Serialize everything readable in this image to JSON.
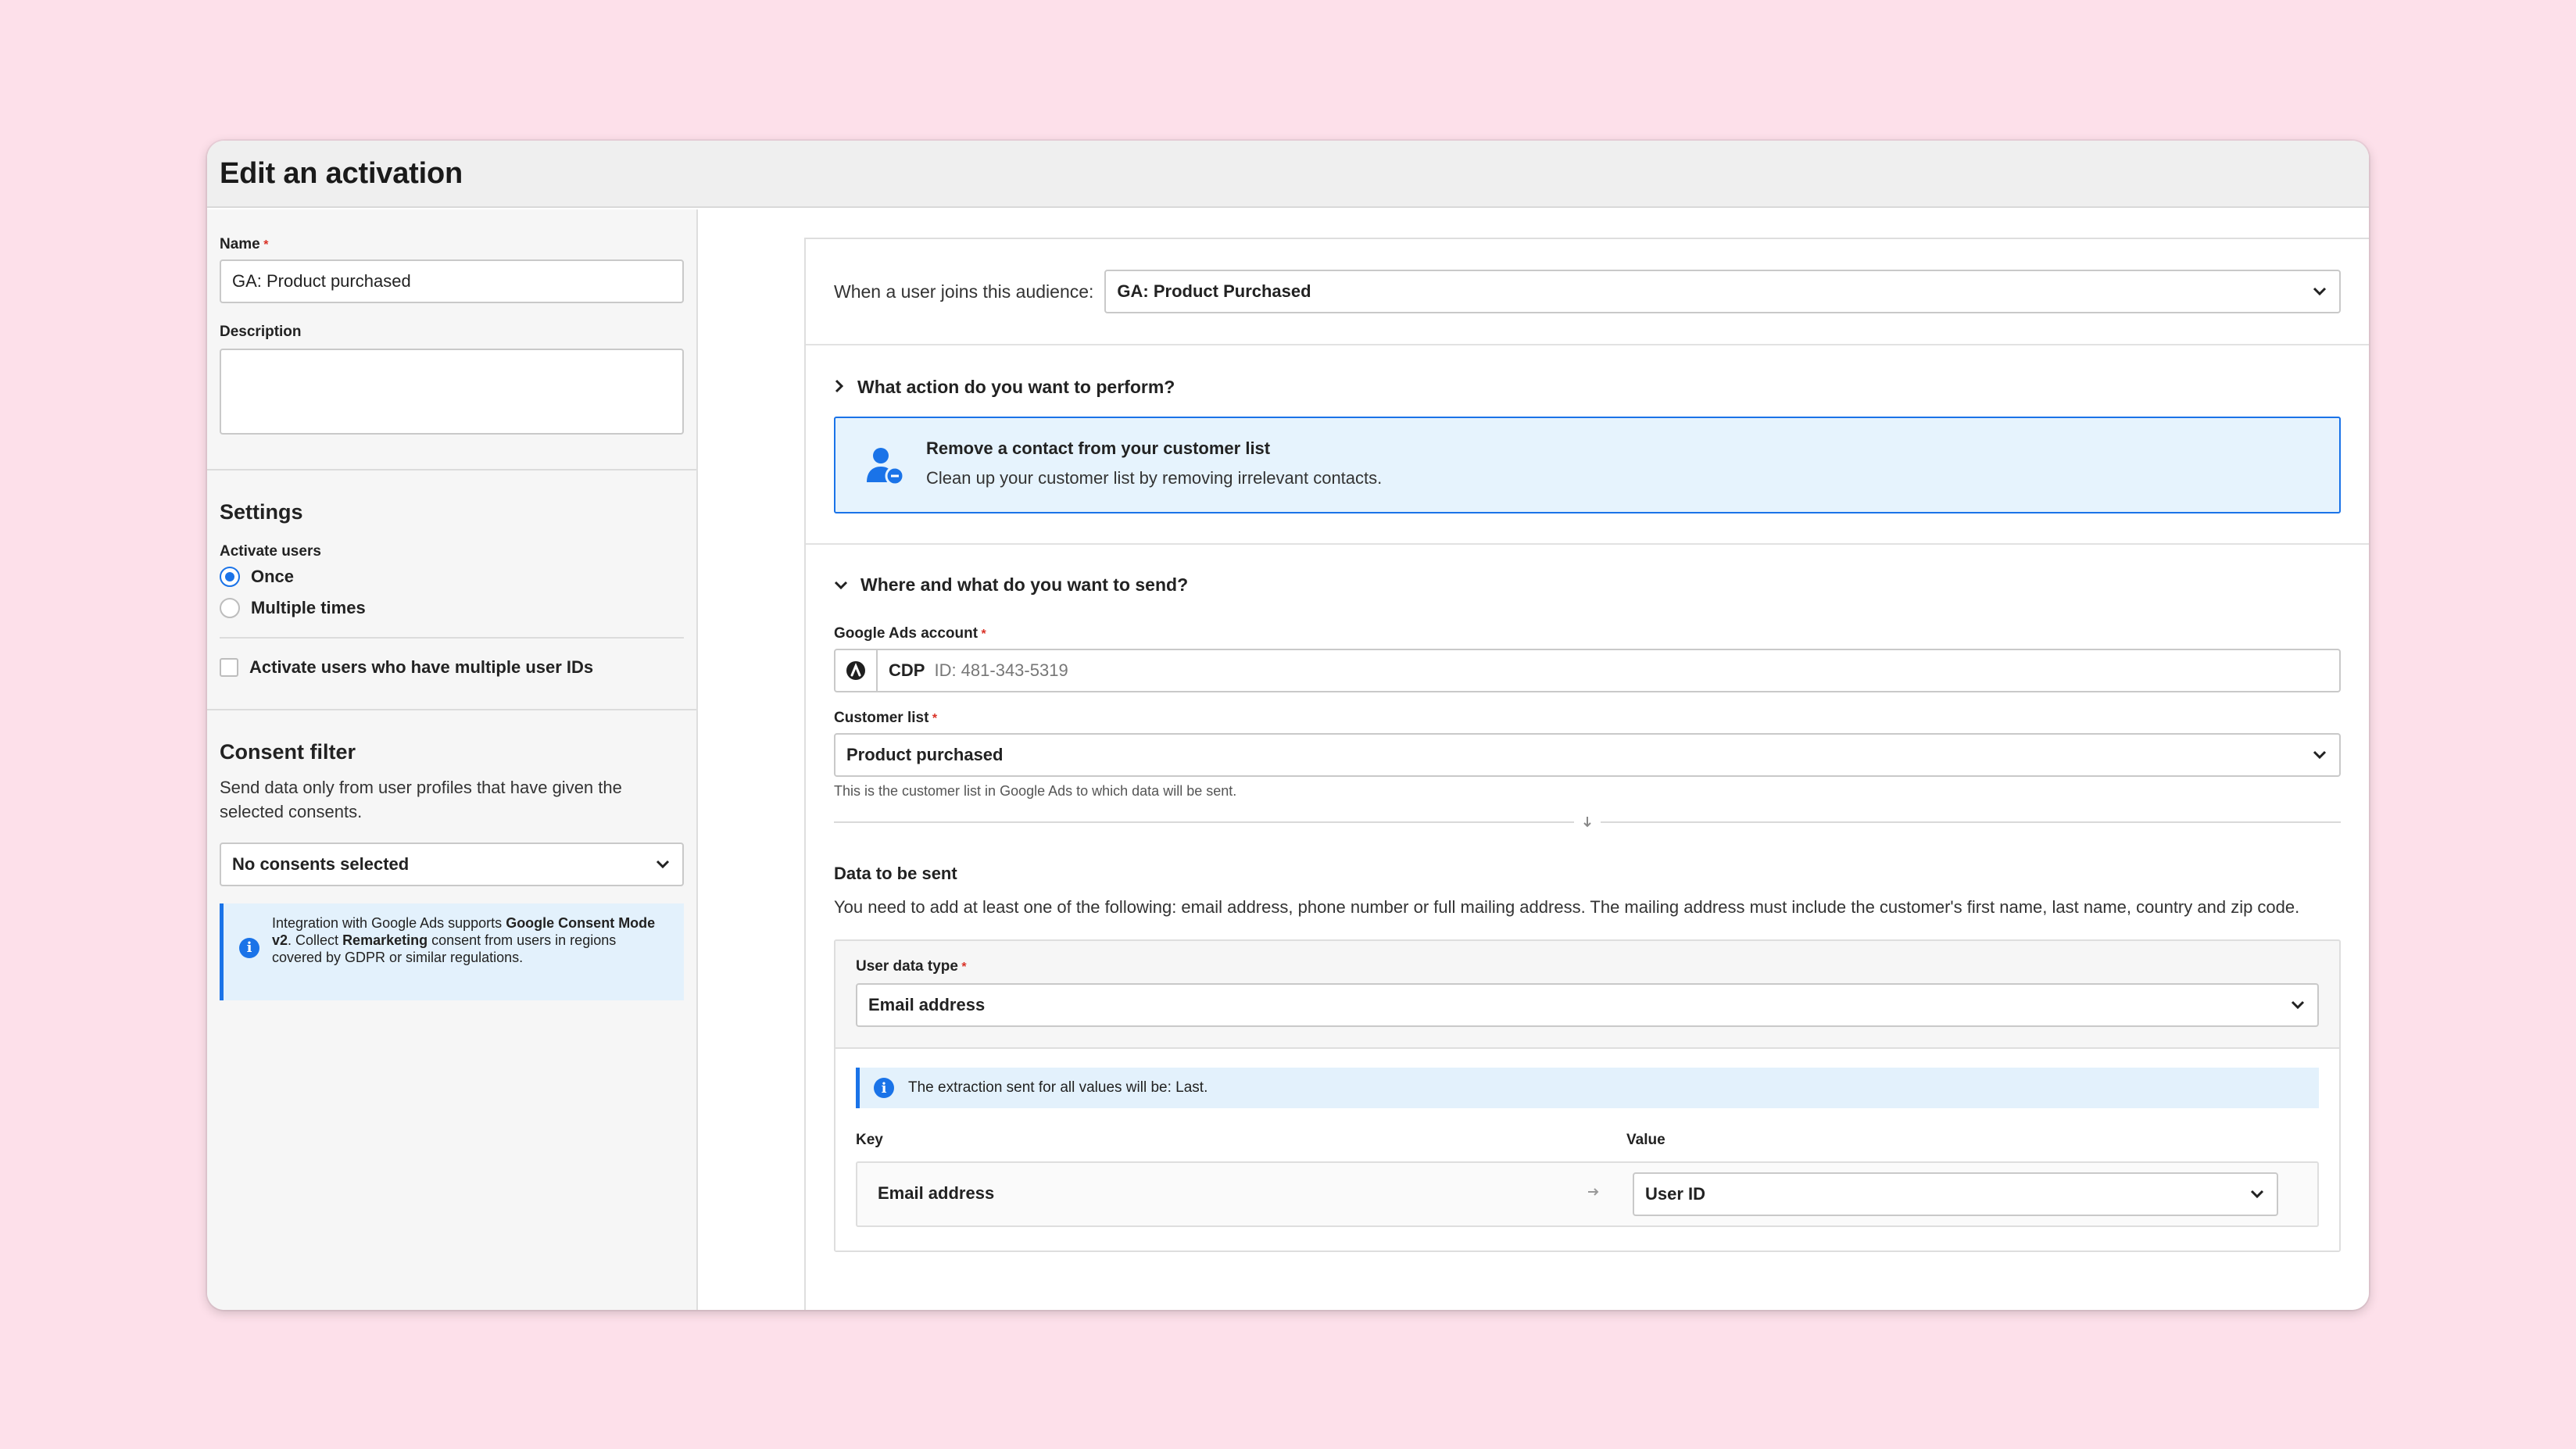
{
  "title": "Edit an activation",
  "left": {
    "name_label": "Name",
    "required_mark": "*",
    "name_value": "GA: Product purchased",
    "description_label": "Description",
    "description_value": "",
    "settings_heading": "Settings",
    "activate_users_label": "Activate users",
    "radio_once": "Once",
    "radio_multiple": "Multiple times",
    "radio_selected": "Once",
    "checkbox_label": "Activate users who have multiple user IDs",
    "checkbox_checked": false,
    "consent_heading": "Consent filter",
    "consent_desc": "Send data only from user profiles that have given the selected consents.",
    "consent_select": "No consents selected",
    "info_text_1": "Integration with Google Ads supports ",
    "info_bold_1": "Google Consent Mode v2",
    "info_text_2": ". Collect ",
    "info_bold_2": "Remarketing",
    "info_text_3": " consent from users in regions covered by GDPR or similar regulations."
  },
  "right": {
    "audience_label": "When a user joins this audience:",
    "audience_value": "GA: Product Purchased",
    "action_heading": "What action do you want to perform?",
    "action_title": "Remove a contact from your customer list",
    "action_desc": "Clean up your customer list by removing irrelevant contacts.",
    "send_heading": "Where and what do you want to send?",
    "ads_account_label": "Google Ads account",
    "ads_account_name": "CDP",
    "ads_account_id": "ID: 481-343-5319",
    "customer_list_label": "Customer list",
    "customer_list_value": "Product purchased",
    "customer_list_help": "This is the customer list in Google Ads to which data will be sent.",
    "data_heading": "Data to be sent",
    "data_desc": "You need to add at least one of the following: email address, phone number or full mailing address. The mailing address must include the customer's first name, last name, country and zip code.",
    "user_data_type_label": "User data type",
    "user_data_type_value": "Email address",
    "extraction_info": "The extraction sent for all values will be: Last.",
    "key_header": "Key",
    "value_header": "Value",
    "key_value": "Email address",
    "value_select": "User ID"
  },
  "colors": {
    "background": "#fde0ea",
    "accent": "#1a73e8",
    "required": "#d93025",
    "info_bg": "#e3f1fc"
  }
}
